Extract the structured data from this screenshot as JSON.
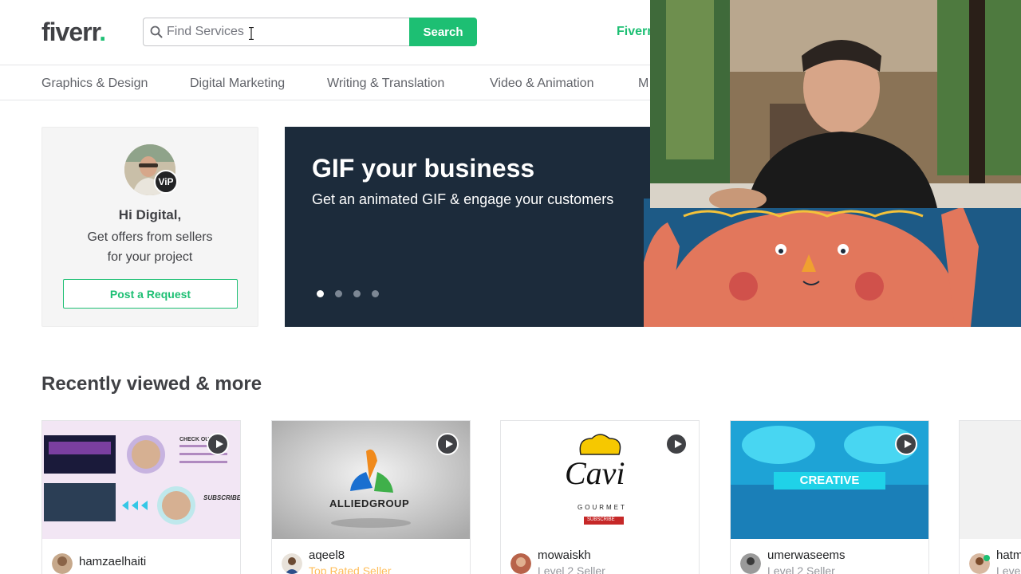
{
  "header": {
    "logo_text": "fiverr",
    "logo_dot": ".",
    "search_placeholder": "Find Services",
    "search_button": "Search",
    "nav_link_partial": "Fiverr"
  },
  "categories": [
    "Graphics & Design",
    "Digital Marketing",
    "Writing & Translation",
    "Video & Animation",
    "M"
  ],
  "welcome": {
    "vip_badge": "ViP",
    "greeting": "Hi Digital,",
    "offer_line1": "Get offers from sellers",
    "offer_line2": "for your project",
    "post_button": "Post a Request"
  },
  "banner": {
    "title": "GIF your business",
    "subtitle": "Get an animated GIF & engage your customers",
    "slide_count": 4,
    "active_slide": 1
  },
  "recently_viewed": {
    "title": "Recently viewed & more",
    "gigs": [
      {
        "seller": "hamzaelhaiti",
        "level": "",
        "thumb_text": "",
        "thumb_text2": "",
        "subscribe": "SUBSCRIBE",
        "check_out": "CHECK OUT"
      },
      {
        "seller": "aqeel8",
        "level": "Top Rated Seller",
        "thumb_text": "ALLIEDGROUP",
        "thumb_text2": ""
      },
      {
        "seller": "mowaiskh",
        "level": "Level 2 Seller",
        "thumb_text": "Cavi",
        "thumb_text2": "GOURMET",
        "subscribe": "SUBSCRIBE"
      },
      {
        "seller": "umerwaseems",
        "level": "Level 2 Seller",
        "thumb_text": "CREATIVE",
        "thumb_text2": ""
      },
      {
        "seller": "hatm",
        "level": "Leve",
        "thumb_text": "",
        "thumb_text2": ""
      }
    ]
  },
  "colors": {
    "brand_green": "#1dbf73",
    "text_dark": "#404145",
    "text_muted": "#62646a",
    "banner_bg": "#1c2b3b",
    "top_rated": "#ffbe5b"
  }
}
